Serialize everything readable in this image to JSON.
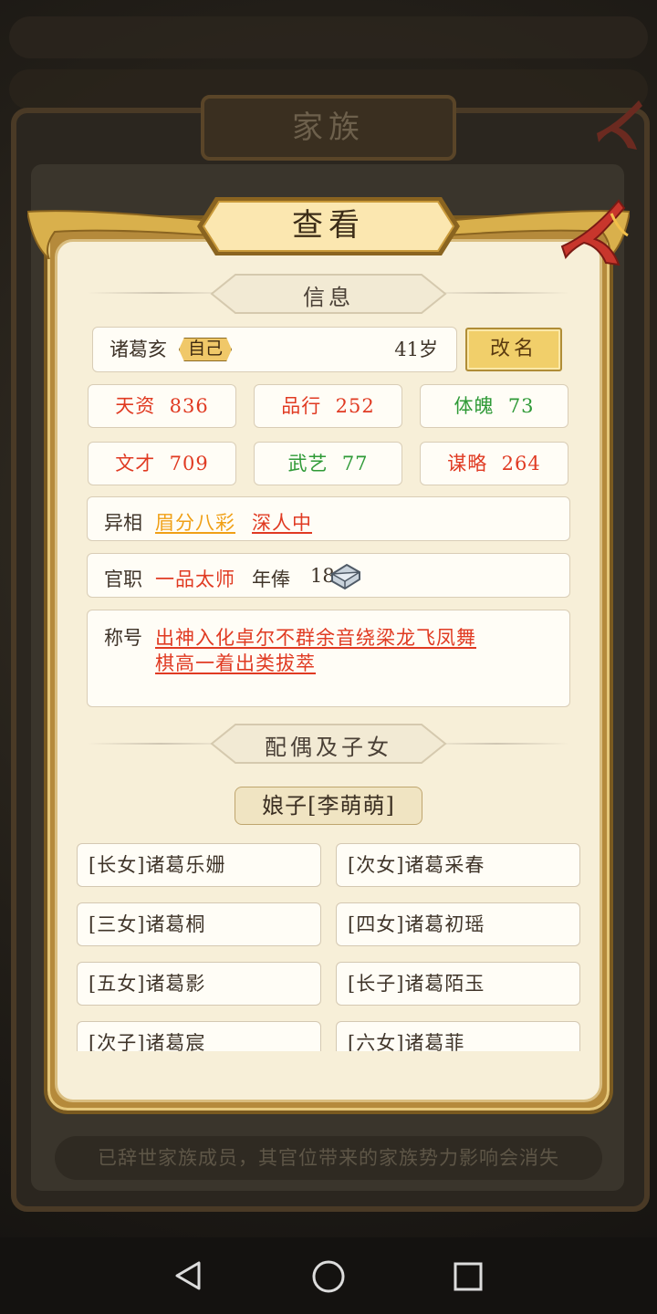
{
  "background": {
    "title": "家族",
    "footer_notice": "已辞世家族成员，其官位带来的家族势力影响会消失"
  },
  "dialog": {
    "title": "查看",
    "info_header": "信息",
    "name": "诸葛亥",
    "self_tag": "自己",
    "age": "41岁",
    "rename_label": "改名",
    "stats": [
      {
        "label": "天资",
        "value": "836",
        "color": "red"
      },
      {
        "label": "品行",
        "value": "252",
        "color": "red"
      },
      {
        "label": "体魄",
        "value": "73",
        "color": "green"
      },
      {
        "label": "文才",
        "value": "709",
        "color": "red"
      },
      {
        "label": "武艺",
        "value": "77",
        "color": "green"
      },
      {
        "label": "谋略",
        "value": "264",
        "color": "red"
      }
    ],
    "appearance": {
      "label": "异相",
      "traits": [
        "眉分八彩",
        "深人中"
      ]
    },
    "office": {
      "label": "官职",
      "rank": "一品太师",
      "salary_label": "年俸",
      "salary_value": "18",
      "salary_icon": "silver-ingot-icon"
    },
    "titles": {
      "label": "称号",
      "line1": "出神入化卓尔不群余音绕梁龙飞凤舞",
      "line2": "棋高一着出类拔萃"
    },
    "family_header": "配偶及子女",
    "spouse": "娘子[李萌萌]",
    "children": [
      "[长女]诸葛乐姗",
      "[次女]诸葛采春",
      "[三女]诸葛桐",
      "[四女]诸葛初瑶",
      "[五女]诸葛影",
      "[长子]诸葛陌玉",
      "[次子]诸葛宸",
      "[六女]诸葛菲"
    ]
  },
  "colors": {
    "red": "#e03a22",
    "green": "#2f9a37",
    "orange": "#f0a016",
    "panel": "#f7efd8",
    "gold": "#f1cf6a"
  }
}
